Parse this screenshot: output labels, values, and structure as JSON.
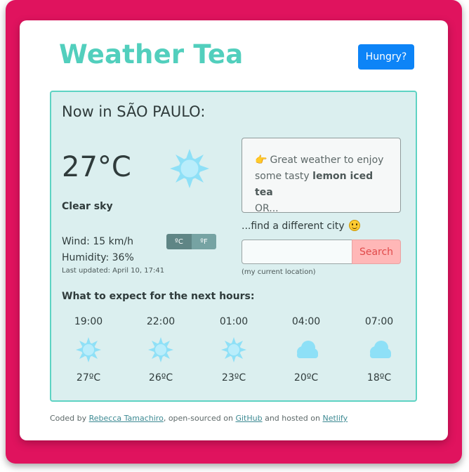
{
  "app": {
    "title": "Weather Tea",
    "hungry_label": "Hungry?"
  },
  "current": {
    "heading": "Now in SÃO PAULO:",
    "temperature": "27°C",
    "description": "Clear sky",
    "wind": "Wind: 15 km/h",
    "humidity": "Humidity: 36%",
    "last_updated": "Last updated: April 10, 17:41",
    "icon": "sun-icon"
  },
  "units": {
    "celsius_label": "ºC",
    "fahrenheit_label": "ºF"
  },
  "suggestion": {
    "prefix": "Great weather to enjoy some tasty ",
    "drink": "lemon iced tea",
    "suffix": "OR..."
  },
  "search": {
    "prompt": "...find a different city",
    "placeholder": "",
    "value": "",
    "button_label": "Search",
    "location_link": "(my current location)"
  },
  "forecast": {
    "title": "What to expect for the next hours:",
    "items": [
      {
        "time": "19:00",
        "temp": "27ºC",
        "icon": "sun-icon"
      },
      {
        "time": "22:00",
        "temp": "26ºC",
        "icon": "sun-icon"
      },
      {
        "time": "01:00",
        "temp": "23ºC",
        "icon": "sun-icon"
      },
      {
        "time": "04:00",
        "temp": "20ºC",
        "icon": "cloud-icon"
      },
      {
        "time": "07:00",
        "temp": "18ºC",
        "icon": "cloud-icon"
      }
    ]
  },
  "footer": {
    "prefix": "Coded by ",
    "author": "Rebecca Tamachiro",
    "middle": ", open-sourced on ",
    "github": "GitHub",
    "middle2": " and hosted on ",
    "host": "Netlify"
  },
  "colors": {
    "frame": "#e0135e",
    "title": "#52cfbd",
    "panel_bg": "#dbefef",
    "panel_border": "#5ed3c3",
    "hungry_button": "#0d84f7",
    "search_button": "#ffb7b7",
    "weather_icon": "#8ee0f7"
  }
}
